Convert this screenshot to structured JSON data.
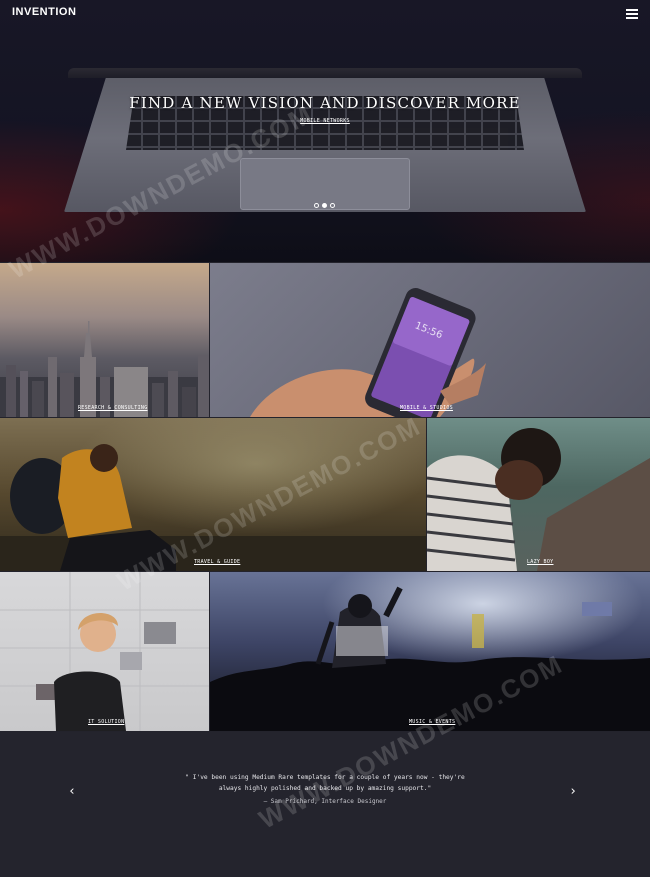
{
  "brand": {
    "logo_text": "INVENTION"
  },
  "nav": {
    "menu_icon": "hamburger-menu-icon"
  },
  "hero": {
    "title": "FIND A NEW VISION AND DISCOVER MORE",
    "subtitle": "MOBILE NETWORKS",
    "slides_count": 3,
    "active_slide": 2
  },
  "gallery": [
    {
      "caption": "RESEARCH & CONSULTING"
    },
    {
      "caption": "MOBILE & STUDIOS"
    },
    {
      "caption": "TRAVEL & GUIDE"
    },
    {
      "caption": "LAZY BOY"
    },
    {
      "caption": "IT SOLUTION"
    },
    {
      "caption": "MUSIC & EVENTS"
    }
  ],
  "testimonial": {
    "quote_line1": "\" I've been using Medium Rare templates for a couple of years now - they're",
    "quote_line2": "always highly polished and backed up by amazing support.\"",
    "author": "— Sam Prichard, Interface Designer",
    "prev_icon": "chevron-left-icon",
    "next_icon": "chevron-right-icon"
  },
  "watermark": {
    "text": "WWW.DOWNDEMO.COM"
  }
}
